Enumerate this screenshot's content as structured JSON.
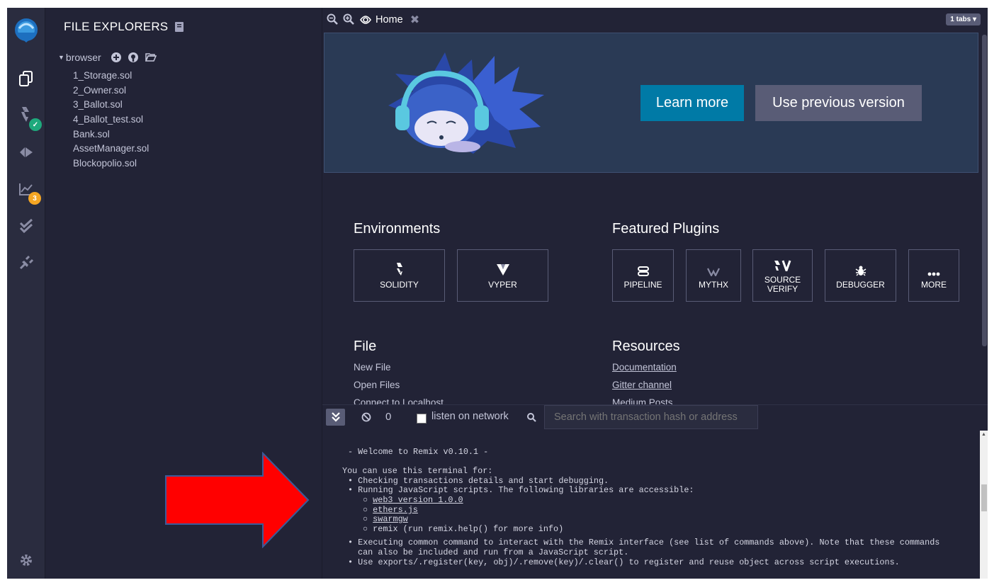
{
  "sidebar": {
    "title": "FILE EXPLORERS",
    "tree_root": "browser",
    "files": [
      "1_Storage.sol",
      "2_Owner.sol",
      "3_Ballot.sol",
      "4_Ballot_test.sol",
      "Bank.sol",
      "AssetManager.sol",
      "Blockopolio.sol"
    ]
  },
  "iconbar": {
    "analysis_badge": "3"
  },
  "tabs": {
    "home_label": "Home",
    "tabs_count_label": "1 tabs"
  },
  "hero": {
    "learn_more": "Learn more",
    "use_previous": "Use previous version"
  },
  "environments": {
    "title": "Environments",
    "items": [
      "SOLIDITY",
      "VYPER"
    ]
  },
  "featured_plugins": {
    "title": "Featured Plugins",
    "items": [
      "PIPELINE",
      "MYTHX",
      "SOURCE VERIFY",
      "DEBUGGER",
      "MORE"
    ]
  },
  "file_section": {
    "title": "File",
    "links": [
      "New File",
      "Open Files",
      "Connect to Localhost"
    ]
  },
  "resources": {
    "title": "Resources",
    "links": [
      "Documentation",
      "Gitter channel",
      "Medium Posts"
    ]
  },
  "terminal_bar": {
    "count": "0",
    "listen_label": "listen on network",
    "search_placeholder": "Search with transaction hash or address"
  },
  "terminal": {
    "welcome": "- Welcome to Remix v0.10.1 -",
    "intro": "You can use this terminal for:",
    "bullet1": "Checking transactions details and start debugging.",
    "bullet2": "Running JavaScript scripts. The following libraries are accessible:",
    "lib1": "web3 version 1.0.0",
    "lib2": "ethers.js",
    "lib3": "swarmgw",
    "lib4": "remix (run remix.help() for more info)",
    "bullet3a": "Executing common command to interact with the Remix interface (see list of commands above). Note that these commands",
    "bullet3b": "can also be included and run from a JavaScript script.",
    "bullet4": "Use exports/.register(key, obj)/.remove(key)/.clear() to register and reuse object across script executions."
  },
  "colors": {
    "accent": "#007aa6",
    "secondary": "#595c76",
    "background": "#222336",
    "arrow": "#ff0000"
  }
}
